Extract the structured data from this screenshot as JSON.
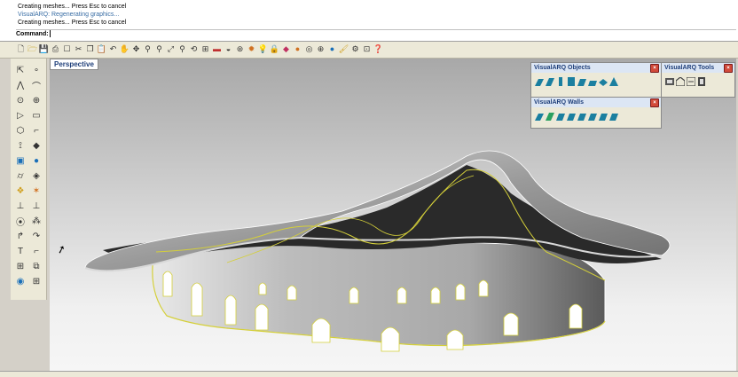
{
  "command_history": [
    "Creating meshes... Press Esc to cancel",
    "VisualARQ: Regenerating graphics...",
    "Creating meshes... Press Esc to cancel"
  ],
  "command_prompt": "Command:",
  "viewport": {
    "label": "Perspective"
  },
  "panels": {
    "objects": {
      "title": "VisualARQ Objects"
    },
    "walls": {
      "title": "VisualARQ Walls"
    },
    "tools": {
      "title": "VisualARQ Tools"
    }
  },
  "colors": {
    "accent": "#1f3f7a",
    "highlight": "#d4cf3a",
    "panel_title_bg": "#dce6f4"
  }
}
